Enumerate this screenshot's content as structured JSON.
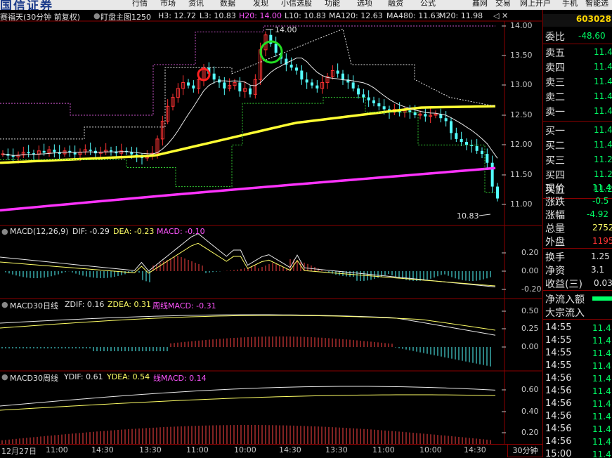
{
  "app": {
    "logo": "国信证券"
  },
  "menu": [
    "行情",
    "市场",
    "资讯",
    "数据",
    "发现",
    "小信选股",
    "功能",
    "选项",
    "融资",
    "公式",
    "鑫网",
    "交易",
    "网上开户",
    "手机",
    "智能选"
  ],
  "stock_header": {
    "name": "赛福天(30分钟 前复权)",
    "indicator": "盯盘主图1250",
    "items": [
      {
        "label": "H3: 12.72",
        "color": "#e0e0e0"
      },
      {
        "label": "L3: 10.83",
        "color": "#e0e0e0"
      },
      {
        "label": "H20: 14.00",
        "color": "#ff55ff"
      },
      {
        "label": "L10: 10.83",
        "color": "#e0e0e0"
      },
      {
        "label": "MA120: 12.63",
        "color": "#e0e0e0"
      },
      {
        "label": "MA480: 11.63",
        "color": "#e0e0e0"
      },
      {
        "label": "M20: 11.98",
        "color": "#e0e0e0"
      }
    ],
    "window_icons": "◁ ✕"
  },
  "price_axis": [
    "14.00",
    "13.50",
    "13.00",
    "12.50",
    "12.00",
    "11.50",
    "11.00"
  ],
  "annotations": {
    "high": "14.00",
    "low": "10.83"
  },
  "sub_panels": [
    {
      "title": "MACD(12,26,9)",
      "items": [
        {
          "label": "DIF: -0.29",
          "color": "#e0e0e0"
        },
        {
          "label": "DEA: -0.23",
          "color": "#ffff66"
        },
        {
          "label": "MACD: -0.10",
          "color": "#ff55ff"
        }
      ],
      "axis": [
        "0.20",
        "0.00",
        "-0.20"
      ]
    },
    {
      "title": "MACD30日线",
      "items": [
        {
          "label": "ZDIF: 0.16",
          "color": "#e0e0e0"
        },
        {
          "label": "ZDEA: 0.31",
          "color": "#ffff66"
        },
        {
          "label": "周线MACD: -0.31",
          "color": "#ff55ff"
        }
      ],
      "axis": [
        "0.50",
        "0.25",
        "0.00"
      ]
    },
    {
      "title": "MACD30周线",
      "items": [
        {
          "label": "YDIF: 0.61",
          "color": "#e0e0e0"
        },
        {
          "label": "YDEA: 0.54",
          "color": "#ffff66"
        },
        {
          "label": "线MACD: 0.14",
          "color": "#ff55ff"
        }
      ],
      "axis": [
        "0.60",
        "0.40",
        "0.20"
      ]
    }
  ],
  "time_axis": [
    "12月27日",
    "11:00",
    "14:30",
    "13:30",
    "11:00",
    "10:00",
    "14:30",
    "13:30",
    "11:00",
    "10:00",
    "14:30"
  ],
  "period_button": "30分钟",
  "quote_panel": {
    "code": "603028",
    "wei_bi": {
      "label": "委比",
      "value": "-48.60"
    },
    "sell": [
      {
        "label": "卖五",
        "value": "11.4"
      },
      {
        "label": "卖四",
        "value": "11.4"
      },
      {
        "label": "卖三",
        "value": "11.4"
      },
      {
        "label": "卖二",
        "value": "11.4"
      },
      {
        "label": "卖一",
        "value": "11.4"
      }
    ],
    "buy": [
      {
        "label": "买一",
        "value": "11.4"
      },
      {
        "label": "买二",
        "value": "11.4"
      },
      {
        "label": "买三",
        "value": "11.2"
      },
      {
        "label": "买四",
        "value": "11.2"
      },
      {
        "label": "买五",
        "value": "11.2"
      }
    ],
    "stats": [
      {
        "label": "现价",
        "value": "11.4",
        "color": "#00ff66"
      },
      {
        "label": "涨跌",
        "value": "-0.5",
        "color": "#00ff66"
      },
      {
        "label": "涨幅",
        "value": "-4.92",
        "color": "#00ff66"
      },
      {
        "label": "总量",
        "value": "2752",
        "color": "#ffff66"
      },
      {
        "label": "外盘",
        "value": "1195",
        "color": "#ff3333"
      }
    ],
    "stats2": [
      {
        "label": "换手",
        "value": "1.25",
        "color": "#e0e0e0"
      },
      {
        "label": "净资",
        "value": "3.1",
        "color": "#e0e0e0"
      },
      {
        "label": "收益(三)",
        "value": "0.03",
        "color": "#e0e0e0"
      }
    ],
    "flow": [
      {
        "label": "净流入额"
      },
      {
        "label": "大宗流入"
      }
    ],
    "ticks": [
      {
        "time": "14:55",
        "price": "11.4"
      },
      {
        "time": "14:55",
        "price": "11.4"
      },
      {
        "time": "14:55",
        "price": "11.4"
      },
      {
        "time": "14:55",
        "price": "11.4"
      },
      {
        "time": "14:56",
        "price": "11.4"
      },
      {
        "time": "14:56",
        "price": "11.4"
      },
      {
        "time": "14:56",
        "price": "11.4"
      },
      {
        "time": "14:56",
        "price": "11.4"
      },
      {
        "time": "14:56",
        "price": "11.4"
      },
      {
        "time": "14:56",
        "price": "11.4"
      },
      {
        "time": "15:00",
        "price": "11.4"
      }
    ]
  }
}
